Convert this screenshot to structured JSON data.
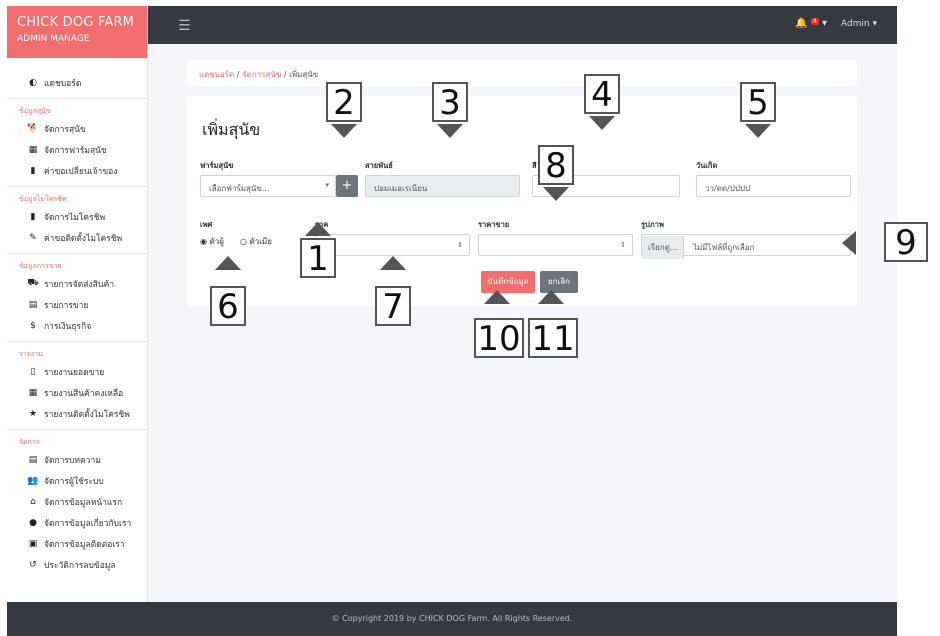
{
  "brand": {
    "title": "CHICK DOG FARM",
    "subtitle": "ADMIN MANAGE"
  },
  "sidebar": {
    "dashboard": "แดชบอร์ด",
    "sections": [
      {
        "title": "ข้อมูลสุนัข",
        "items": [
          {
            "icon": "dog-icon",
            "glyph": "🐕",
            "label": "จัดการสุนัข"
          },
          {
            "icon": "farm-icon",
            "glyph": "▦",
            "label": "จัดการฟาร์มสุนัข"
          },
          {
            "icon": "bookmark-icon",
            "glyph": "▮",
            "label": "ค่าขอเปลี่ยนเจ้าของ"
          }
        ]
      },
      {
        "title": "ข้อมูลไมโครชิพ",
        "items": [
          {
            "icon": "chip-icon",
            "glyph": "▮",
            "label": "จัดการไมโครชิพ"
          },
          {
            "icon": "wrench-icon",
            "glyph": "✎",
            "label": "ค่าขอติดตั้งไมโครชิพ"
          }
        ]
      },
      {
        "title": "ข้อมูลการขาย",
        "items": [
          {
            "icon": "truck-icon",
            "glyph": "⛟",
            "label": "รายการจัดส่งสินค้า"
          },
          {
            "icon": "receipt-icon",
            "glyph": "▤",
            "label": "รายการขาย"
          },
          {
            "icon": "dollar-icon",
            "glyph": "$",
            "label": "การเงินธุรกิจ"
          }
        ]
      },
      {
        "title": "รายงาน",
        "items": [
          {
            "icon": "file-icon",
            "glyph": "▯",
            "label": "รายงานยอดขาย"
          },
          {
            "icon": "calendar-icon",
            "glyph": "▦",
            "label": "รายงานสินค้าคงเหลือ"
          },
          {
            "icon": "star-icon",
            "glyph": "★",
            "label": "รายงานติดตั้งไมโครชิพ"
          }
        ]
      },
      {
        "title": "จัดการ",
        "items": [
          {
            "icon": "article-icon",
            "glyph": "▤",
            "label": "จัดการบทความ"
          },
          {
            "icon": "users-icon",
            "glyph": "👥",
            "label": "จัดการผู้ใช้ระบบ"
          },
          {
            "icon": "home-icon",
            "glyph": "⌂",
            "label": "จัดการข้อมูลหน้าแรก"
          },
          {
            "icon": "info-icon",
            "glyph": "●",
            "label": "จัดการข้อมูลเกี่ยวกับเรา"
          },
          {
            "icon": "contact-card-icon",
            "glyph": "▣",
            "label": "จัดการข้อมูลติดต่อเรา"
          },
          {
            "icon": "history-icon",
            "glyph": "↺",
            "label": "ประวัติการลบข้อมูล"
          }
        ]
      }
    ]
  },
  "topbar": {
    "badge": "4",
    "user": "Admin"
  },
  "breadcrumb": {
    "home": "แดชบอร์ด",
    "parent": "จัดการสุนัข",
    "current": "เพิ่มสุนัข"
  },
  "form": {
    "title": "เพิ่มสุนัข",
    "farm_label": "ฟาร์มสุนัข",
    "farm_value": "เลือกฟาร์มสุนัข...",
    "breed_label": "สายพันธ์",
    "breed_value": "ปอมเมอเรเนียน",
    "color_label": "สี",
    "birth_label": "วันเกิด",
    "birth_placeholder": "วว/ดด/ปปปป",
    "sex_label": "เพศ",
    "male": "ตัวผู้",
    "female": "ตัวเมีย",
    "price_label": "ราค",
    "sell_label": "ราคาขาย",
    "image_label": "รูปภาพ",
    "file_button": "เรียกดู...",
    "file_status": "ไม่มีไฟล์ที่ถูกเลือก",
    "save": "บันทึกข้อมูล",
    "cancel": "ยกเลิก"
  },
  "footer": "© Copyright 2019 by CHICK DOG Farm. All Rights Reserved.",
  "annotations": [
    "1",
    "2",
    "3",
    "4",
    "5",
    "6",
    "7",
    "8",
    "9",
    "10",
    "11"
  ],
  "colors": {
    "accent": "#f26d6d",
    "dark": "#343a40",
    "cancel": "#6c757d"
  }
}
